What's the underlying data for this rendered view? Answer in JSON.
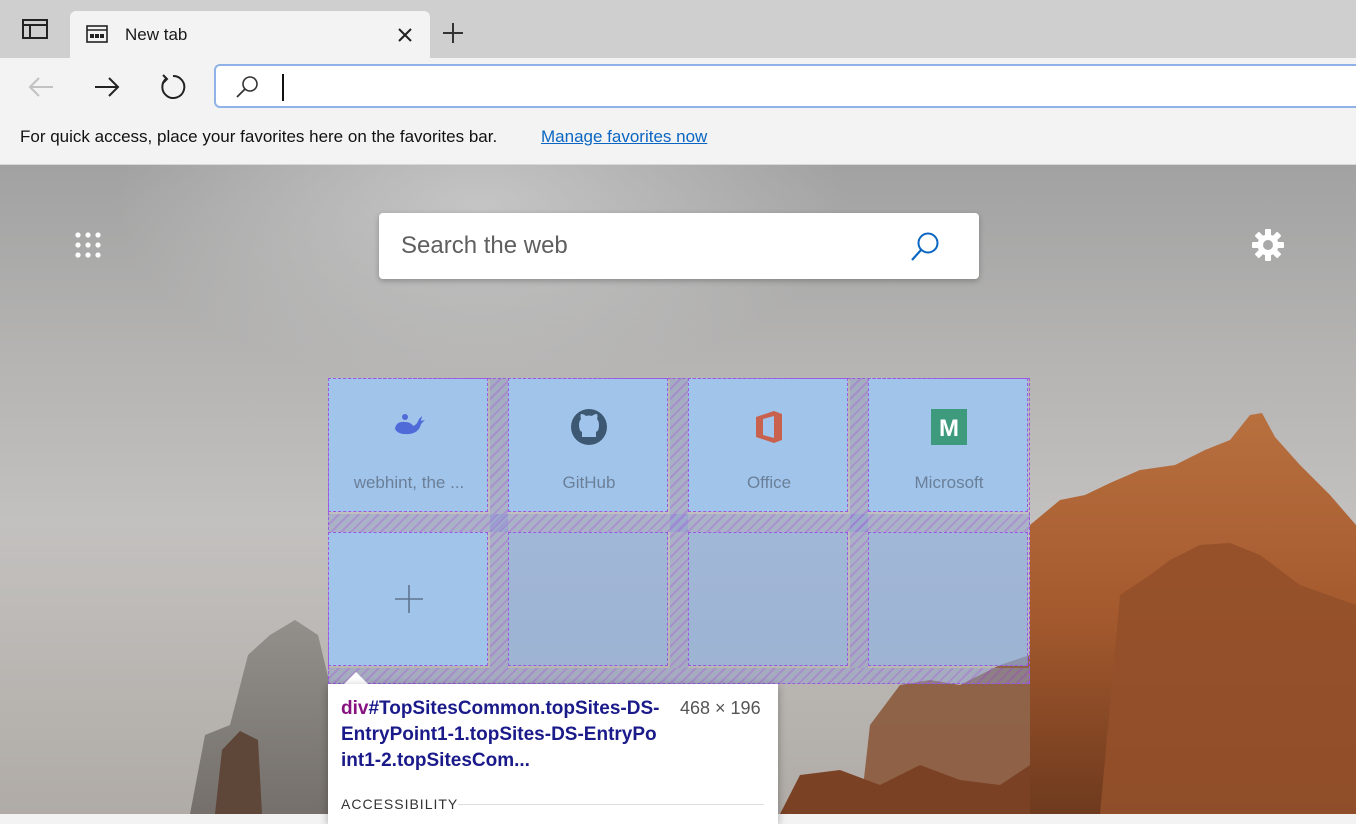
{
  "tab": {
    "title": "New tab"
  },
  "favorites_bar": {
    "message": "For quick access, place your favorites here on the favorites bar.",
    "link": "Manage favorites now"
  },
  "search": {
    "placeholder": "Search the web"
  },
  "top_sites": [
    {
      "label": "webhint, the ...",
      "icon": "webhint-icon"
    },
    {
      "label": "GitHub",
      "icon": "github-icon"
    },
    {
      "label": "Office",
      "icon": "office-icon"
    },
    {
      "label": "Microsoft",
      "icon": "microsoft-m-icon",
      "letter": "M"
    }
  ],
  "inspect_tooltip": {
    "tag": "div",
    "selector": "#TopSitesCommon.topSites-DS-EntryPoint1-1.topSites-DS-EntryPoint1-2.topSitesCom...",
    "dimensions": "468 × 196",
    "section": "ACCESSIBILITY"
  },
  "colors": {
    "accent": "#0a66c2",
    "grid_highlight": "#9b59e0",
    "tile_bg": "#a0c4ec"
  }
}
